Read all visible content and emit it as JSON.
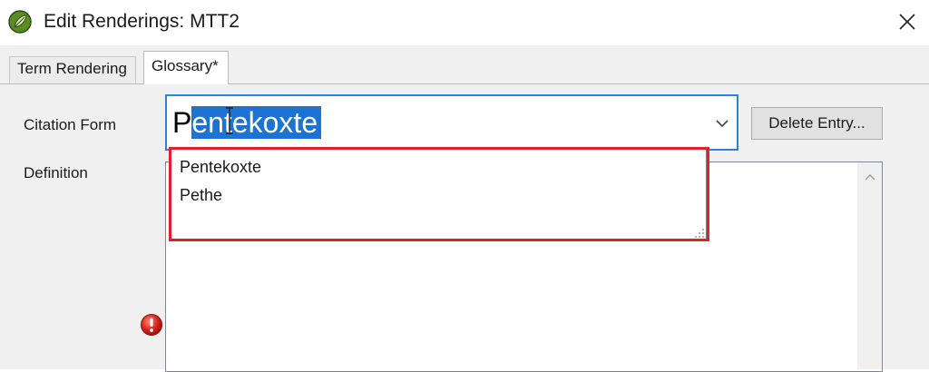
{
  "window": {
    "title": "Edit Renderings: MTT2",
    "app_icon": "leaf-icon",
    "close_icon": "close-icon"
  },
  "tabs": [
    {
      "label": "Term Rendering",
      "active": false
    },
    {
      "label": "Glossary*",
      "active": true
    }
  ],
  "form": {
    "citation_label": "Citation Form",
    "citation_value_plain": "P",
    "citation_value_selected": "entekoxte",
    "definition_label": "Definition",
    "delete_button_label": "Delete Entry..."
  },
  "dropdown": {
    "items": [
      "Pentekoxte",
      "Pethe"
    ]
  },
  "colors": {
    "selection": "#1e73d2",
    "focus_border": "#2f7fdc",
    "annotation_red": "#e21f2b",
    "window_bg": "#f0f0f0"
  },
  "icons": {
    "warning": "error-icon",
    "combo_arrow": "chevron-down-icon",
    "scroll_up": "chevron-up-icon",
    "text_cursor": "ibeam-cursor-icon"
  }
}
